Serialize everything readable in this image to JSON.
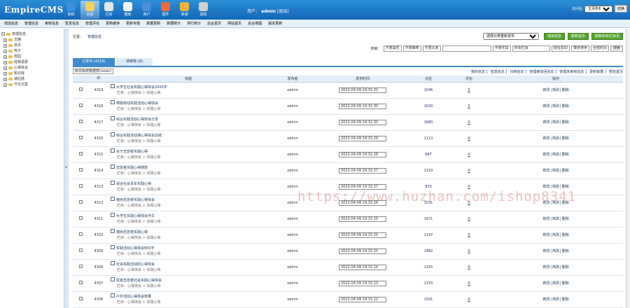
{
  "header": {
    "logo": "EmpireCMS",
    "nav": [
      {
        "label": "系统",
        "icon": "system-icon",
        "color": "#3b8ee0"
      },
      {
        "label": "信息",
        "icon": "edit-icon",
        "color": "#f3d15a"
      },
      {
        "label": "栏目",
        "icon": "folder-icon",
        "color": "#e6e6e6"
      },
      {
        "label": "模板",
        "icon": "template-icon",
        "color": "#f4f4f4"
      },
      {
        "label": "用户",
        "icon": "user-icon",
        "color": "#4a90d9"
      },
      {
        "label": "插件",
        "icon": "plugin-icon",
        "color": "#f06a3a"
      },
      {
        "label": "商城",
        "icon": "shop-icon",
        "color": "#f2b13b"
      },
      {
        "label": "其他",
        "icon": "gear-icon",
        "color": "#d0d0d0"
      }
    ],
    "user_label": "用户：",
    "user_name": "admin",
    "logout": "[退出]",
    "visit_label": "访问后",
    "visit_select": "主页所有",
    "go_button": "切换"
  },
  "menubar": [
    "增加信息",
    "管理信息",
    "审核信息",
    "签发信息",
    "管理评论",
    "更新缓存",
    "更新专题",
    "数据更新",
    "数据统计",
    "排行统计",
    "后台首页",
    "网站首页",
    "后台地图",
    "版本更新"
  ],
  "sidebar": {
    "root": "管理信息",
    "items": [
      "文摘",
      "资讯",
      "电子",
      "校园",
      "经典语录",
      "心得体会",
      "知识库",
      "读后感",
      "节日文案"
    ]
  },
  "main": {
    "position_label": "位置：",
    "position_link": "管理信息",
    "move_select": "选择分类重新发布",
    "btn_add": "增加信息",
    "btn_refresh": "刷新首页",
    "btn_refresh_all": "刷新所有栏目页",
    "search": {
      "label": "搜索：",
      "filters": [
        "不限属性",
        "不限推荐",
        "不限头条"
      ],
      "field": "不限字段",
      "column": "所有栏目",
      "order": "按信息ID",
      "dir": "降序排序",
      "time": "全部时间",
      "button": "搜索"
    },
    "tabs": {
      "published": "已发布 (4319)",
      "pending": "待审核 (0)"
    },
    "sort_select": "新闻系统数据表(news)",
    "top_links": [
      "我的信息",
      "签发信息",
      "归档信息",
      "管理被驳回信息",
      "管理未审核信息",
      "更新数据",
      "预览首页"
    ],
    "columns": [
      "ID",
      "标题",
      "发布者",
      "发布时间",
      "点击",
      "评论",
      "操作"
    ],
    "column_prefix": "栏目：",
    "ops": [
      "修改",
      "简改",
      "删除"
    ],
    "rows": [
      {
        "id": "4319",
        "title": "大学生社会实践心得体会2000字",
        "column": "心得体会 > 实践心得",
        "author": "admin",
        "time": "2022-04-09 19:31:31",
        "hits": "1046",
        "comments": "0"
      },
      {
        "id": "4318",
        "title": "寒假劳动实践活动心得体会",
        "column": "心得体会 > 实践心得",
        "author": "admin",
        "time": "2022-04-09 19:31:30",
        "hits": "1630",
        "comments": "0"
      },
      {
        "id": "4317",
        "title": "综合实践活动心得体会分享",
        "column": "心得体会 > 实践心得",
        "author": "admin",
        "time": "2022-04-09 19:31:30",
        "hits": "1680",
        "comments": "0"
      },
      {
        "id": "4316",
        "title": "综合实践活动课心得体会总结",
        "column": "心得体会 > 实践心得",
        "author": "admin",
        "time": "2022-04-09 19:31:29",
        "hits": "1113",
        "comments": "0"
      },
      {
        "id": "4315",
        "title": "关于志愿者实践心得",
        "column": "心得体会 > 实践心得",
        "author": "admin",
        "time": "2022-04-09 19:31:28",
        "hits": "687",
        "comments": "0"
      },
      {
        "id": "4314",
        "title": "志愿者实践心得感想",
        "column": "心得体会 > 实践心得",
        "author": "admin",
        "time": "2022-04-09 19:31:27",
        "hits": "1219",
        "comments": "0"
      },
      {
        "id": "4313",
        "title": "适合社会青年实践心得",
        "column": "心得体会 > 实践心得",
        "author": "admin",
        "time": "2022-04-09 19:31:27",
        "hits": "833",
        "comments": "0"
      },
      {
        "id": "4312",
        "title": "植树志愿者实践心得体会",
        "column": "心得体会 > 实践心得",
        "author": "admin",
        "time": "2022-04-09 19:31:26",
        "hits": "1031",
        "comments": "0"
      },
      {
        "id": "4311",
        "title": "大学生实践心得体会作文",
        "column": "心得体会 > 实践心得",
        "author": "admin",
        "time": "2022-04-09 19:31:25",
        "hits": "1671",
        "comments": "0"
      },
      {
        "id": "4310",
        "title": "植树志愿者实践心得",
        "column": "心得体会 > 实践心得",
        "author": "admin",
        "time": "2022-04-09 19:31:25",
        "hits": "1197",
        "comments": "0"
      },
      {
        "id": "4309",
        "title": "实践活动心得体会600字",
        "column": "心得体会 > 实践心得",
        "author": "admin",
        "time": "2022-04-09 19:31:25",
        "hits": "1482",
        "comments": "0"
      },
      {
        "id": "4308",
        "title": "社会实践活动的心得体会",
        "column": "心得体会 > 实践心得",
        "author": "admin",
        "time": "2022-04-09 19:31:24",
        "hits": "1325",
        "comments": "0"
      },
      {
        "id": "4307",
        "title": "抗疫志愿者社会实践心得体会",
        "column": "心得体会 > 实践心得",
        "author": "admin",
        "time": "2022-04-09 19:31:23",
        "hits": "1370",
        "comments": "0"
      },
      {
        "id": "4306",
        "title": "户外活动心得体会有哪",
        "column": "心得体会 > 实践心得",
        "author": "admin",
        "time": "2022-04-09 19:31:22",
        "hits": "1501",
        "comments": "0"
      }
    ]
  },
  "watermark": "https://www.huzhan.com/ishop8341"
}
